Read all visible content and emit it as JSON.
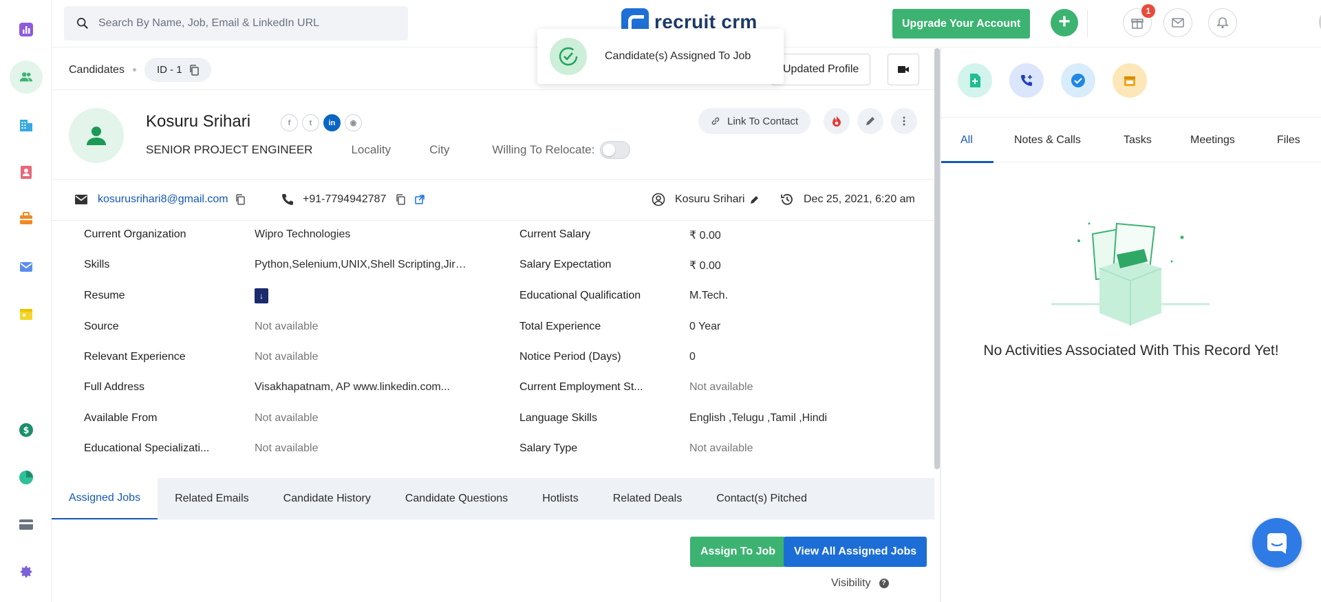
{
  "search": {
    "placeholder": "Search By Name, Job, Email & LinkedIn URL"
  },
  "brand": {
    "name": "recruit crm"
  },
  "topbar": {
    "upgrade_label": "Upgrade Your Account",
    "gift_badge": "1"
  },
  "breadcrumb": {
    "section": "Candidates",
    "id_label": "ID - 1"
  },
  "toast": {
    "message": "Candidate(s) Assigned To Job"
  },
  "header_actions": {
    "updated_profile_label": "Updated Profile"
  },
  "candidate": {
    "name": "Kosuru Srihari",
    "title": "SENIOR PROJECT ENGINEER",
    "locality": "Locality",
    "city": "City",
    "relocate_label": "Willing To Relocate:",
    "link_contact_label": "Link To Contact",
    "email": "kosurusrihari8@gmail.com",
    "phone": "+91-7794942787",
    "owner": "Kosuru Srihari",
    "created": "Dec 25, 2021, 6:20 am"
  },
  "details_left": [
    {
      "label": "Current Organization",
      "value": "Wipro Technologies",
      "na": false
    },
    {
      "label": "Skills",
      "value": "Python,Selenium,UNIX,Shell Scripting,Jira...",
      "na": false
    },
    {
      "label": "Resume",
      "value": "",
      "na": false
    },
    {
      "label": "Source",
      "value": "Not available",
      "na": true
    },
    {
      "label": "Relevant Experience",
      "value": "Not available",
      "na": true
    },
    {
      "label": "Full Address",
      "value": "Visakhapatnam, AP www.linkedin.com...",
      "na": false
    },
    {
      "label": "Available From",
      "value": "Not available",
      "na": true
    },
    {
      "label": "Educational Specializati...",
      "value": "Not available",
      "na": true
    }
  ],
  "details_right": [
    {
      "label": "Current Salary",
      "value": "₹ 0.00",
      "na": false
    },
    {
      "label": "Salary Expectation",
      "value": "₹ 0.00",
      "na": false
    },
    {
      "label": "Educational Qualification",
      "value": "M.Tech.",
      "na": false
    },
    {
      "label": "Total Experience",
      "value": "0 Year",
      "na": false
    },
    {
      "label": "Notice Period (Days)",
      "value": "0",
      "na": false
    },
    {
      "label": "Current Employment St...",
      "value": "Not available",
      "na": true
    },
    {
      "label": "Language Skills",
      "value": "English ,Telugu ,Tamil ,Hindi",
      "na": false
    },
    {
      "label": "Salary Type",
      "value": "Not available",
      "na": true
    }
  ],
  "bottom_tabs": [
    "Assigned Jobs",
    "Related Emails",
    "Candidate History",
    "Candidate Questions",
    "Hotlists",
    "Related Deals",
    "Contact(s) Pitched"
  ],
  "assigned": {
    "assign_label": "Assign To Job",
    "view_all_label": "View All Assigned Jobs",
    "visibility_label": "Visibility"
  },
  "activity_tabs": [
    "All",
    "Notes & Calls",
    "Tasks",
    "Meetings",
    "Files"
  ],
  "activity_empty": "No Activities Associated With This Record Yet!",
  "colors": {
    "accent_green": "#3cb371",
    "accent_blue": "#1c6ed6",
    "link_blue": "#1557b8"
  }
}
